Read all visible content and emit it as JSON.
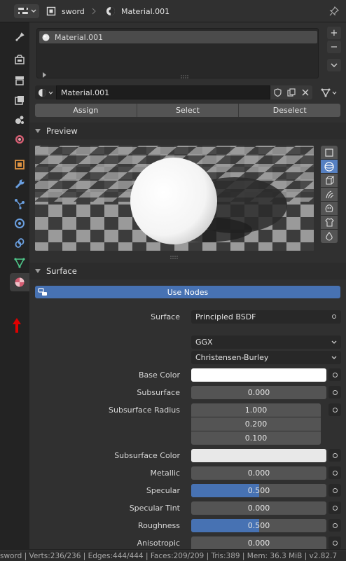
{
  "header": {
    "object_name": "sword",
    "material_name": "Material.001"
  },
  "sidebar": {
    "tabs": [
      {
        "name": "tool-tab-icon",
        "color": "#c9c9c9"
      },
      {
        "name": "render-tab-icon",
        "color": "#c9c9c9"
      },
      {
        "name": "output-tab-icon",
        "color": "#c9c9c9"
      },
      {
        "name": "view-layer-tab-icon",
        "color": "#c9c9c9"
      },
      {
        "name": "scene-tab-icon",
        "color": "#c9c9c9"
      },
      {
        "name": "world-tab-icon",
        "color": "#d45d72"
      },
      {
        "name": "object-tab-icon",
        "color": "#e09442"
      },
      {
        "name": "modifier-tab-icon",
        "color": "#6a9fe0"
      },
      {
        "name": "particles-tab-icon",
        "color": "#6a9fe0"
      },
      {
        "name": "physics-tab-icon",
        "color": "#6a9fe0"
      },
      {
        "name": "constraints-tab-icon",
        "color": "#6a9fe0"
      },
      {
        "name": "data-tab-icon",
        "color": "#4fc78a"
      },
      {
        "name": "material-tab-icon",
        "color": "#d45d72"
      }
    ]
  },
  "slots": {
    "items": [
      "Material.001"
    ]
  },
  "material": {
    "name": "Material.001",
    "assign": "Assign",
    "select": "Select",
    "deselect": "Deselect"
  },
  "preview": {
    "title": "Preview"
  },
  "surface": {
    "title": "Surface",
    "use_nodes": "Use Nodes",
    "surface_label": "Surface",
    "surface_value": "Principled BSDF",
    "distribution": "GGX",
    "subsurface_method": "Christensen-Burley",
    "base_color_label": "Base Color",
    "base_color": "#ffffff",
    "subsurface_label": "Subsurface",
    "subsurface": "0.000",
    "subsurface_radius_label": "Subsurface Radius",
    "subsurface_radius": [
      "1.000",
      "0.200",
      "0.100"
    ],
    "subsurface_color_label": "Subsurface Color",
    "subsurface_color": "#e8e8e8",
    "metallic_label": "Metallic",
    "metallic": "0.000",
    "specular_label": "Specular",
    "specular": "0.500",
    "specular_fraction": 0.5,
    "specular_tint_label": "Specular Tint",
    "specular_tint": "0.000",
    "roughness_label": "Roughness",
    "roughness": "0.500",
    "roughness_fraction": 0.5,
    "anisotropic_label": "Anisotropic",
    "anisotropic": "0.000"
  },
  "status": {
    "text": "sword | Verts:236/236 | Edges:444/444 | Faces:209/209 | Tris:389 | Mem: 36.3 MiB | v2.82.7"
  }
}
